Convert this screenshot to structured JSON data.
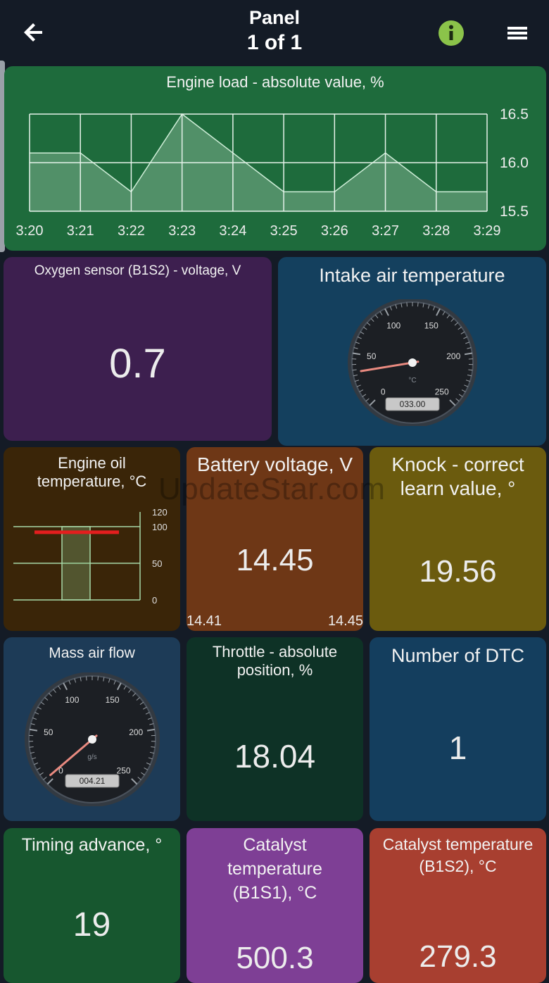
{
  "header": {
    "title": "Panel",
    "page": "1 of 1",
    "back_icon": "arrow-left-icon",
    "info_icon": "info-icon",
    "menu_icon": "hamburger-menu-icon",
    "info_color": "#8bc34a"
  },
  "watermark": "UpdateStar.com",
  "tiles": {
    "engine_load": {
      "title": "Engine load - absolute value, %",
      "bg": "#1e6b3c",
      "chart_data": {
        "type": "area",
        "x": [
          "3:20",
          "3:21",
          "3:22",
          "3:23",
          "3:24",
          "3:25",
          "3:26",
          "3:27",
          "3:28",
          "3:29"
        ],
        "values": [
          16.1,
          16.1,
          15.7,
          16.5,
          16.1,
          15.7,
          15.7,
          16.1,
          15.7,
          15.7
        ],
        "y_ticks": [
          "16.5",
          "16.0",
          "15.5"
        ],
        "ylim": [
          15.5,
          16.5
        ],
        "grid": true
      }
    },
    "oxygen": {
      "title": "Oxygen sensor (B1S2) - voltage, V",
      "value": "0.7",
      "bg": "#3d1f4f"
    },
    "intake": {
      "title": "Intake air temperature",
      "bg": "#14405e",
      "gauge": {
        "ticks": [
          "0",
          "50",
          "100",
          "150",
          "200",
          "250"
        ],
        "unit": "°C",
        "readout": "033.00",
        "value": 33,
        "max": 250
      }
    },
    "oil": {
      "title": "Engine oil temperature, °C",
      "bg": "#3a2508",
      "chart_data": {
        "type": "bar",
        "values": [
          100
        ],
        "limit": 100,
        "ylim": [
          0,
          120
        ],
        "y_ticks": [
          "120",
          "100",
          "50",
          "0"
        ]
      }
    },
    "battery": {
      "title": "Battery voltage, V",
      "value": "14.45",
      "min": "14.41",
      "max": "14.45",
      "bg": "#6e3716"
    },
    "knock": {
      "title": "Knock - correct learn value, °",
      "value": "19.56",
      "bg": "#6b5b0e"
    },
    "maf": {
      "title": "Mass air flow",
      "bg": "#1d3b57",
      "gauge": {
        "ticks": [
          "0",
          "50",
          "100",
          "150",
          "200",
          "250"
        ],
        "unit": "g/s",
        "readout": "004.21",
        "value": 4.21,
        "max": 250
      }
    },
    "throttle": {
      "title": "Throttle - absolute position, %",
      "value": "18.04",
      "bg": "#0e3226"
    },
    "dtc": {
      "title": "Number of DTC",
      "value": "1",
      "bg": "#143e5e"
    },
    "timing": {
      "title": "Timing advance, °",
      "value": "19",
      "bg": "#17572f"
    },
    "cat1": {
      "title": "Catalyst temperature (B1S1), °C",
      "value": "500.3",
      "bg": "#7e3f95"
    },
    "cat2": {
      "title": "Catalyst temperature (B1S2), °C",
      "value": "279.3",
      "bg": "#a83f30"
    }
  }
}
